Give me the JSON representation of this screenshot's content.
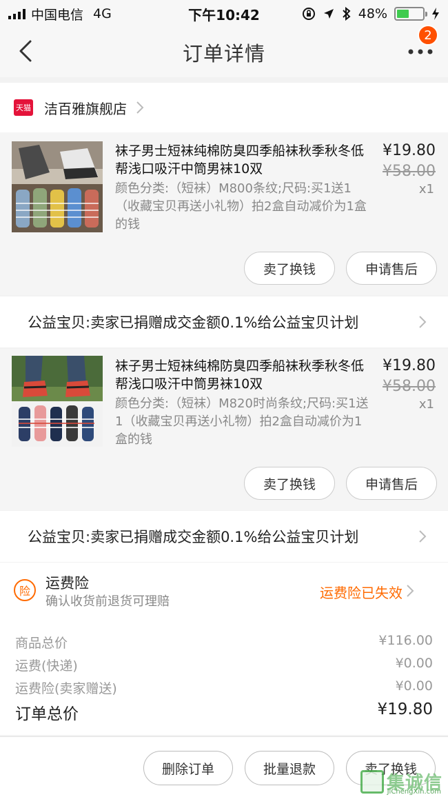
{
  "status_bar": {
    "carrier": "中国电信",
    "network": "4G",
    "time": "下午10:42",
    "battery": "48%",
    "battery_level": 0.48
  },
  "nav": {
    "title": "订单详情",
    "badge": "2"
  },
  "shop": {
    "badge": "天猫",
    "name": "洁百雅旗舰店"
  },
  "items": [
    {
      "title": "袜子男士短袜纯棉防臭四季船袜秋季秋冬低帮浅口吸汗中筒男袜10双",
      "spec": "颜色分类:（短袜）M800条纹;尺码:买1送1（收藏宝贝再送小礼物）拍2盒自动减价为1盒的钱",
      "price": "¥19.80",
      "orig_price": "¥58.00",
      "qty": "x1",
      "btn_sell": "卖了换钱",
      "btn_after": "申请售后"
    },
    {
      "title": "袜子男士短袜纯棉防臭四季船袜秋季秋冬低帮浅口吸汗中筒男袜10双",
      "spec": "颜色分类:（短袜）M820时尚条纹;尺码:买1送1（收藏宝贝再送小礼物）拍2盒自动减价为1盒的钱",
      "price": "¥19.80",
      "orig_price": "¥58.00",
      "qty": "x1",
      "btn_sell": "卖了换钱",
      "btn_after": "申请售后"
    }
  ],
  "charity": {
    "text": "公益宝贝:卖家已捐赠成交金额0.1%给公益宝贝计划"
  },
  "insurance": {
    "icon_char": "险",
    "title": "运费险",
    "subtitle": "确认收货前退货可理赔",
    "status": "运费险已失效"
  },
  "totals": {
    "goods_label": "商品总价",
    "goods_value": "¥116.00",
    "shipping_label": "运费(快递)",
    "shipping_value": "¥0.00",
    "ins_label": "运费险(卖家赠送)",
    "ins_value": "¥0.00",
    "order_label": "订单总价",
    "order_value": "¥19.80"
  },
  "bottom": {
    "delete": "删除订单",
    "refund": "批量退款",
    "sell": "卖了换钱"
  },
  "watermark": {
    "text": "集诚信",
    "url": "JiChengXin.com"
  },
  "colors": {
    "accent": "#ff5000",
    "insurance": "#ff6a00",
    "tmall": "#e4133a"
  }
}
